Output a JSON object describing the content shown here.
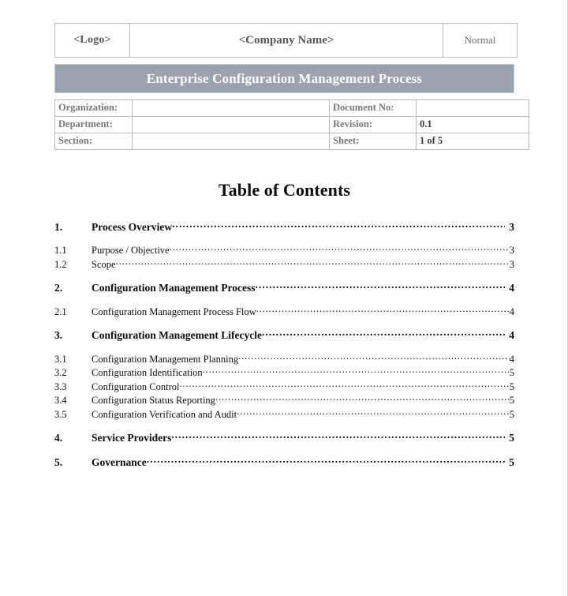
{
  "header": {
    "logo_label": "<Logo>",
    "company_label": "<Company Name>",
    "classification": "Normal"
  },
  "banner": {
    "title": "Enterprise Configuration Management Process",
    "background_color": "#9aa2ae",
    "text_color": "#ffffff"
  },
  "meta": {
    "rows": [
      {
        "label": "Organization:",
        "value": "",
        "label2": "Document No:",
        "value2": ""
      },
      {
        "label": "Department:",
        "value": "",
        "label2": "Revision:",
        "value2": "0.1"
      },
      {
        "label": "Section:",
        "value": "",
        "label2": "Sheet:",
        "value2": "1 of 5"
      }
    ]
  },
  "toc": {
    "heading": "Table of Contents",
    "entries": [
      {
        "number": "1.",
        "title": "Process Overview",
        "page": "3",
        "level": 1
      },
      {
        "number": "1.1",
        "title": "Purpose / Objective",
        "page": "3",
        "level": 2
      },
      {
        "number": "1.2",
        "title": "Scope",
        "page": "3",
        "level": 2
      },
      {
        "number": "2.",
        "title": "Configuration Management Process",
        "page": "4",
        "level": 1
      },
      {
        "number": "2.1",
        "title": "Configuration Management Process Flow",
        "page": "4",
        "level": 2
      },
      {
        "number": "3.",
        "title": "Configuration Management Lifecycle",
        "page": "4",
        "level": 1
      },
      {
        "number": "3.1",
        "title": "Configuration Management Planning",
        "page": "4",
        "level": 2
      },
      {
        "number": "3.2",
        "title": "Configuration Identification ",
        "page": "5",
        "level": 2
      },
      {
        "number": "3.3",
        "title": "Configuration Control",
        "page": "5",
        "level": 2
      },
      {
        "number": "3.4",
        "title": "Configuration Status Reporting",
        "page": "5",
        "level": 2
      },
      {
        "number": "3.5",
        "title": "Configuration Verification and Audit",
        "page": "5",
        "level": 2
      },
      {
        "number": "4.",
        "title": "Service Providers ",
        "page": "5",
        "level": 1
      },
      {
        "number": "5.",
        "title": "Governance ",
        "page": "5",
        "level": 1
      }
    ]
  }
}
